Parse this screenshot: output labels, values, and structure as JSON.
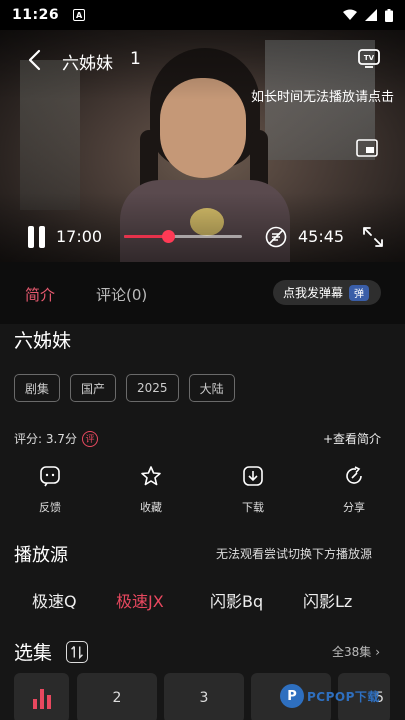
{
  "status_bar": {
    "time": "11:26",
    "notification_icon": "A"
  },
  "player": {
    "title": "六姊妹",
    "episode": "1",
    "marquee": "如长时间无法播放请点击",
    "current_time": "17:00",
    "total_time": "45:45",
    "progress": 0.37,
    "accent": "#e6324b"
  },
  "tabs": {
    "intro": "简介",
    "comments": "评论(0)",
    "danmu_button": "点我发弹幕",
    "danmu_badge": "弹"
  },
  "info": {
    "title": "六姊妹",
    "tags": [
      "剧集",
      "国产",
      "2025",
      "大陆"
    ],
    "rating": "评分: 3.7分",
    "rating_icon": "评",
    "more_intro": "+查看简介"
  },
  "actions": [
    {
      "label": "反馈",
      "icon": "feedback-icon"
    },
    {
      "label": "收藏",
      "icon": "star-icon"
    },
    {
      "label": "下载",
      "icon": "download-icon"
    },
    {
      "label": "分享",
      "icon": "share-icon"
    }
  ],
  "sources": {
    "title": "播放源",
    "hint": "无法观看尝试切换下方播放源",
    "items": [
      "极速Q",
      "极速JX",
      "闪影Bq",
      "闪影Lz"
    ],
    "active_index": 1
  },
  "episodes": {
    "title": "选集",
    "all_label": "全38集",
    "items": [
      "2",
      "3",
      "5"
    ]
  },
  "watermark": {
    "text": "PCPOP下载",
    "logo": "P"
  }
}
